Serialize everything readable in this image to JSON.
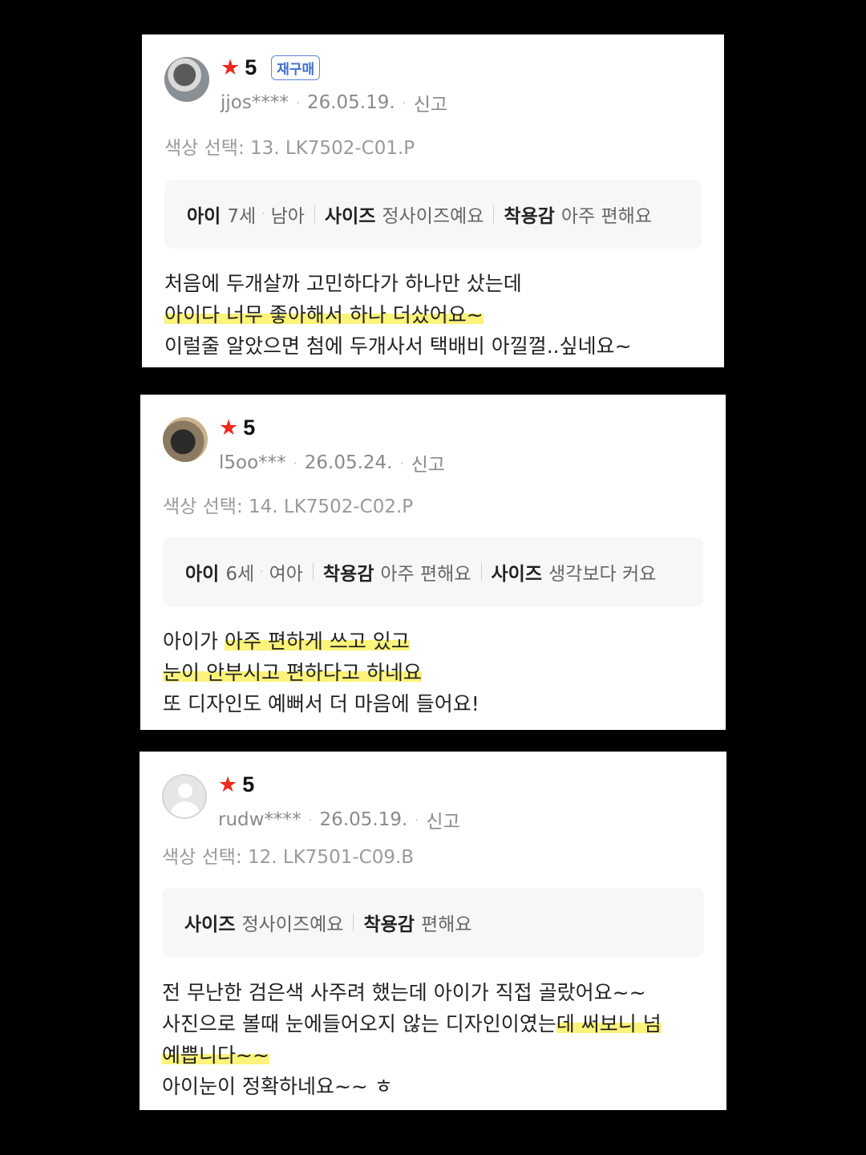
{
  "reviews": [
    {
      "rating_icon": "star-icon",
      "rating": "5",
      "badge": "재구매",
      "user": "jjos****",
      "date": "26.05.19.",
      "report": "신고",
      "option": "색상 선택: 13. LK7502-C01.P",
      "specs": {
        "child_label": "아이",
        "child_age": "7세",
        "child_gender": "남아",
        "spec1_label": "사이즈",
        "spec1_value": "정사이즈예요",
        "spec2_label": "착용감",
        "spec2_value": "아주 편해요"
      },
      "text": {
        "line1": "처음에 두개살까 고민하다가 하나만 샀는데",
        "line2": "아이다 너무 좋아해서 하나 더샀어요~",
        "line3": "이럴줄 알았으면 첨에 두개사서 택배비 아낄껄..싶네요~"
      }
    },
    {
      "rating_icon": "star-icon",
      "rating": "5",
      "user": "l5oo***",
      "date": "26.05.24.",
      "report": "신고",
      "option": "색상 선택: 14. LK7502-C02.P",
      "specs": {
        "child_label": "아이",
        "child_age": "6세",
        "child_gender": "여아",
        "spec1_label": "착용감",
        "spec1_value": "아주 편해요",
        "spec2_label": "사이즈",
        "spec2_value": "생각보다 커요"
      },
      "text": {
        "line1_a": "아이가 ",
        "line1_b": "아주 편하게 쓰고 있고 ",
        "line2": "눈이 안부시고 편하다고 하네요",
        "line3": "또 디자인도 예뻐서  더 마음에 들어요!"
      }
    },
    {
      "rating_icon": "star-icon",
      "rating": "5",
      "user": "rudw****",
      "date": "26.05.19.",
      "report": "신고",
      "option": "색상 선택: 12. LK7501-C09.B",
      "specs": {
        "spec1_label": "사이즈",
        "spec1_value": "정사이즈예요",
        "spec2_label": "착용감",
        "spec2_value": "편해요"
      },
      "text": {
        "line1": "전 무난한 검은색 사주려 했는데 아이가 직접 골랐어요~~",
        "line2_a": "사진으로 볼때 눈에들어오지 않는 디자인이였는",
        "line2_b": "데 써보니 넘",
        "line3": "예쁩니다~~",
        "line4": "아이눈이 정확하네요~~ ㅎ"
      }
    }
  ],
  "colors": {
    "star": "#f0281d",
    "badge": "#3f6fd0",
    "highlight": "#fbf37a"
  }
}
